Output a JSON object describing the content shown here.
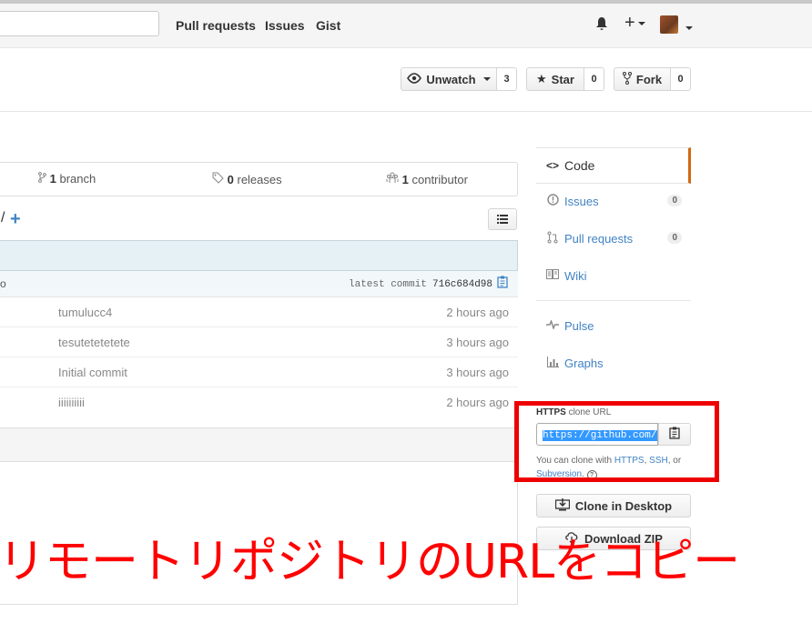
{
  "header": {
    "nav": [
      "Pull requests",
      "Issues",
      "Gist"
    ]
  },
  "pagehead": {
    "watch_label": "Unwatch",
    "watch_count": "3",
    "star_label": "Star",
    "star_count": "0",
    "fork_label": "Fork",
    "fork_count": "0"
  },
  "summary": {
    "branch_count": "1",
    "branch_label": "branch",
    "release_count": "0",
    "release_label": "releases",
    "contributor_count": "1",
    "contributor_label": "contributor"
  },
  "filenav": {
    "path_sep": "/",
    "add": "+"
  },
  "commit": {
    "fragment": "o",
    "latest_label": "latest commit",
    "sha": "716c684d98"
  },
  "files": [
    {
      "message": "tumulucc4",
      "age": "2 hours ago"
    },
    {
      "message": "tesutetetetete",
      "age": "3 hours ago"
    },
    {
      "message": "Initial commit",
      "age": "3 hours ago"
    },
    {
      "message": "iiiiiiiiii",
      "age": "2 hours ago"
    }
  ],
  "sidebar": {
    "code": "Code",
    "issues": "Issues",
    "issues_count": "0",
    "pulls": "Pull requests",
    "pulls_count": "0",
    "wiki": "Wiki",
    "pulse": "Pulse",
    "graphs": "Graphs"
  },
  "clone": {
    "protocol": "HTTPS",
    "label_suffix": "clone URL",
    "url": "https://github.com/:",
    "help_prefix": "You can clone with",
    "https": "HTTPS",
    "comma": ",",
    "ssh": "SSH",
    "or": ", or",
    "subversion": "Subversion",
    "period": ".",
    "desktop_label": "Clone in Desktop",
    "zip_label": "Download ZIP"
  },
  "annotation": {
    "text": "リモートリポジトリのURLをコピー",
    "color": "#ff0000"
  },
  "colors": {
    "link": "#4183c4",
    "selected_border": "#d26911",
    "highlight": "#e00"
  }
}
